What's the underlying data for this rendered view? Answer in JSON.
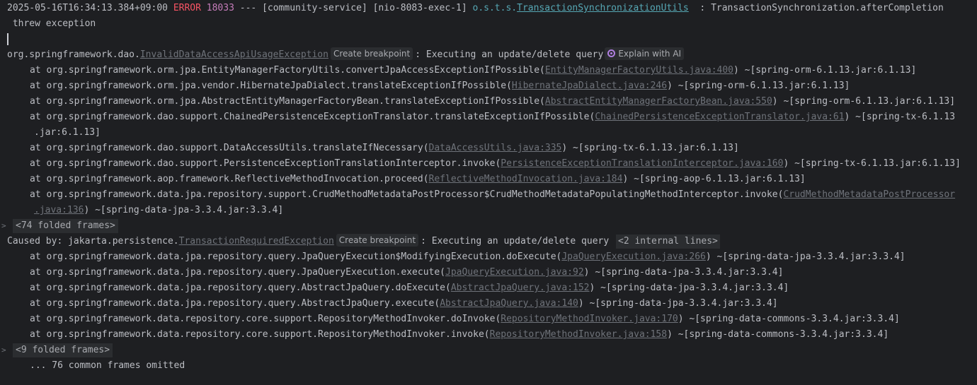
{
  "header": {
    "timestamp": "2025-05-16T16:34:13.384+09:00",
    "level": "ERROR",
    "pid": "18033",
    "separator": "---",
    "app": "[community-service]",
    "thread": "[nio-8083-exec-1]",
    "logger_prefix": "o.s.t.s.",
    "logger_class": "TransactionSynchronizationUtils",
    "message": ": TransactionSynchronization.afterCompletion",
    "message_cont": "threw exception"
  },
  "exception": {
    "prefix": "org.springframework.dao.",
    "class": "InvalidDataAccessApiUsageException",
    "breakpoint": "Create breakpoint",
    "message": ": Executing an update/delete query",
    "ai_label": "Explain with AI"
  },
  "frames1": [
    {
      "pre": "at org.springframework.orm.jpa.EntityManagerFactoryUtils.convertJpaAccessExceptionIfPossible(",
      "link": "EntityManagerFactoryUtils.java:400",
      "post": ") ~[spring-orm-6.1.13.jar:6.1.13]"
    },
    {
      "pre": "at org.springframework.orm.jpa.vendor.HibernateJpaDialect.translateExceptionIfPossible(",
      "link": "HibernateJpaDialect.java:246",
      "post": ") ~[spring-orm-6.1.13.jar:6.1.13]"
    },
    {
      "pre": "at org.springframework.orm.jpa.AbstractEntityManagerFactoryBean.translateExceptionIfPossible(",
      "link": "AbstractEntityManagerFactoryBean.java:550",
      "post": ") ~[spring-orm-6.1.13.jar:6.1.13]"
    },
    {
      "pre": "at org.springframework.dao.support.ChainedPersistenceExceptionTranslator.translateExceptionIfPossible(",
      "link": "ChainedPersistenceExceptionTranslator.java:61",
      "post": ") ~[spring-tx-6.1.13",
      "cont_post": ".jar:6.1.13]"
    },
    {
      "pre": "at org.springframework.dao.support.DataAccessUtils.translateIfNecessary(",
      "link": "DataAccessUtils.java:335",
      "post": ") ~[spring-tx-6.1.13.jar:6.1.13]"
    },
    {
      "pre": "at org.springframework.dao.support.PersistenceExceptionTranslationInterceptor.invoke(",
      "link": "PersistenceExceptionTranslationInterceptor.java:160",
      "post": ") ~[spring-tx-6.1.13.jar:6.1.13]"
    },
    {
      "pre": "at org.springframework.aop.framework.ReflectiveMethodInvocation.proceed(",
      "link": "ReflectiveMethodInvocation.java:184",
      "post": ") ~[spring-aop-6.1.13.jar:6.1.13]"
    },
    {
      "pre": "at org.springframework.data.jpa.repository.support.CrudMethodMetadataPostProcessor$CrudMethodMetadataPopulatingMethodInterceptor.invoke(",
      "link": "CrudMethodMetadataPostProcessor",
      "post": "",
      "cont_link": ".java:136",
      "cont_post": ") ~[spring-data-jpa-3.3.4.jar:3.3.4]"
    }
  ],
  "fold1": "<74 folded frames>",
  "caused": {
    "prefix": "Caused by: jakarta.persistence.",
    "class": "TransactionRequiredException",
    "breakpoint": "Create breakpoint",
    "message": ": Executing an update/delete query",
    "internal": "<2 internal lines>"
  },
  "frames2": [
    {
      "pre": "at org.springframework.data.jpa.repository.query.JpaQueryExecution$ModifyingExecution.doExecute(",
      "link": "JpaQueryExecution.java:266",
      "post": ") ~[spring-data-jpa-3.3.4.jar:3.3.4]"
    },
    {
      "pre": "at org.springframework.data.jpa.repository.query.JpaQueryExecution.execute(",
      "link": "JpaQueryExecution.java:92",
      "post": ") ~[spring-data-jpa-3.3.4.jar:3.3.4]"
    },
    {
      "pre": "at org.springframework.data.jpa.repository.query.AbstractJpaQuery.doExecute(",
      "link": "AbstractJpaQuery.java:152",
      "post": ") ~[spring-data-jpa-3.3.4.jar:3.3.4]"
    },
    {
      "pre": "at org.springframework.data.jpa.repository.query.AbstractJpaQuery.execute(",
      "link": "AbstractJpaQuery.java:140",
      "post": ") ~[spring-data-jpa-3.3.4.jar:3.3.4]"
    },
    {
      "pre": "at org.springframework.data.repository.core.support.RepositoryMethodInvoker.doInvoke(",
      "link": "RepositoryMethodInvoker.java:170",
      "post": ") ~[spring-data-commons-3.3.4.jar:3.3.4]"
    },
    {
      "pre": "at org.springframework.data.repository.core.support.RepositoryMethodInvoker.invoke(",
      "link": "RepositoryMethodInvoker.java:158",
      "post": ") ~[spring-data-commons-3.3.4.jar:3.3.4]"
    }
  ],
  "fold2": "<9 folded frames>",
  "omitted": "... 76 common frames omitted",
  "colors": {
    "background": "#1e1f22",
    "text": "#bcbec4",
    "error": "#f75464",
    "pid": "#c77dbb",
    "logger": "#56a8b5",
    "link": "#6f737a"
  }
}
